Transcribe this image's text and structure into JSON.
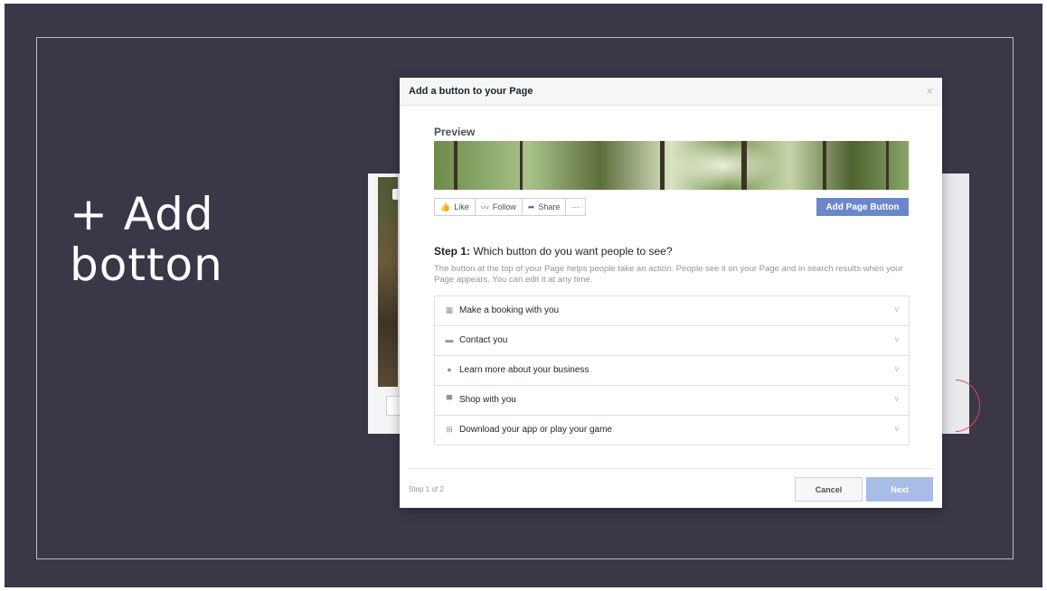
{
  "slide": {
    "title_line1": "+ Add",
    "title_line2": "botton"
  },
  "dialog": {
    "title": "Add a button to your Page",
    "close": "×",
    "preview_label": "Preview",
    "preview_actions": [
      {
        "icon": "like-icon",
        "label": "Like"
      },
      {
        "icon": "follow-icon",
        "label": "Follow"
      },
      {
        "icon": "share-icon",
        "label": "Share"
      },
      {
        "icon": "more-icon",
        "label": "···"
      }
    ],
    "add_page_button": "Add Page Button",
    "step_prefix": "Step 1:",
    "step_question": "Which button do you want people to see?",
    "step_description": "The button at the top of your Page helps people take an action. People see it on your Page and in search results when your Page appears. You can edit it at any time.",
    "options": [
      {
        "icon": "calendar-icon",
        "label": "Make a booking with you"
      },
      {
        "icon": "message-icon",
        "label": "Contact you"
      },
      {
        "icon": "info-icon",
        "label": "Learn more about your business"
      },
      {
        "icon": "shopping-bag-icon",
        "label": "Shop with you"
      },
      {
        "icon": "download-icon",
        "label": "Download your app or play your game"
      }
    ],
    "step_count": "Step 1 of 2",
    "cancel": "Cancel",
    "next": "Next"
  },
  "colors": {
    "slide_background": "#3b3747",
    "facebook_blue": "#6a88c9",
    "next_disabled": "#a9bce6",
    "annotation_red": "#e24a4a"
  }
}
